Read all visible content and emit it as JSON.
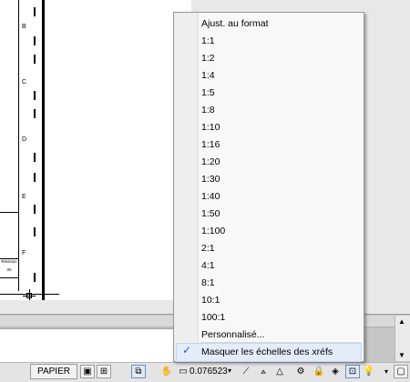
{
  "drawing": {
    "zone_letters": [
      "B",
      "C",
      "D",
      "E",
      "F"
    ],
    "title_block": {
      "label": "Révision",
      "value": "00"
    }
  },
  "scale_menu": {
    "items": [
      "Ajust. au format",
      "1:1",
      "1:2",
      "1:4",
      "1:5",
      "1:8",
      "1:10",
      "1:16",
      "1:20",
      "1:30",
      "1:40",
      "1:50",
      "1:100",
      "2:1",
      "4:1",
      "8:1",
      "10:1",
      "100:1",
      "Personnalisé..."
    ],
    "hide_xref_scales": {
      "label": "Masquer les échelles des xréfs",
      "checked": true
    }
  },
  "status_bar": {
    "paper_button": "PAPIER",
    "scale_value": "0.076523",
    "icons": [
      "model-icon",
      "layout-icon",
      "viewport-icon",
      "hand-icon",
      "annotation-scale-icon",
      "annotation-visibility-icon",
      "auto-scale-icon",
      "workspace-gear-icon",
      "lock-icon",
      "hardware-accel-icon",
      "isolate-icon",
      "lightbulb-icon",
      "menu-arrow-icon",
      "fullscreen-icon"
    ]
  },
  "colors": {
    "check": "#2a5db0",
    "menu_bg": "#f8f8f8",
    "highlight": "#e3ecf8"
  }
}
